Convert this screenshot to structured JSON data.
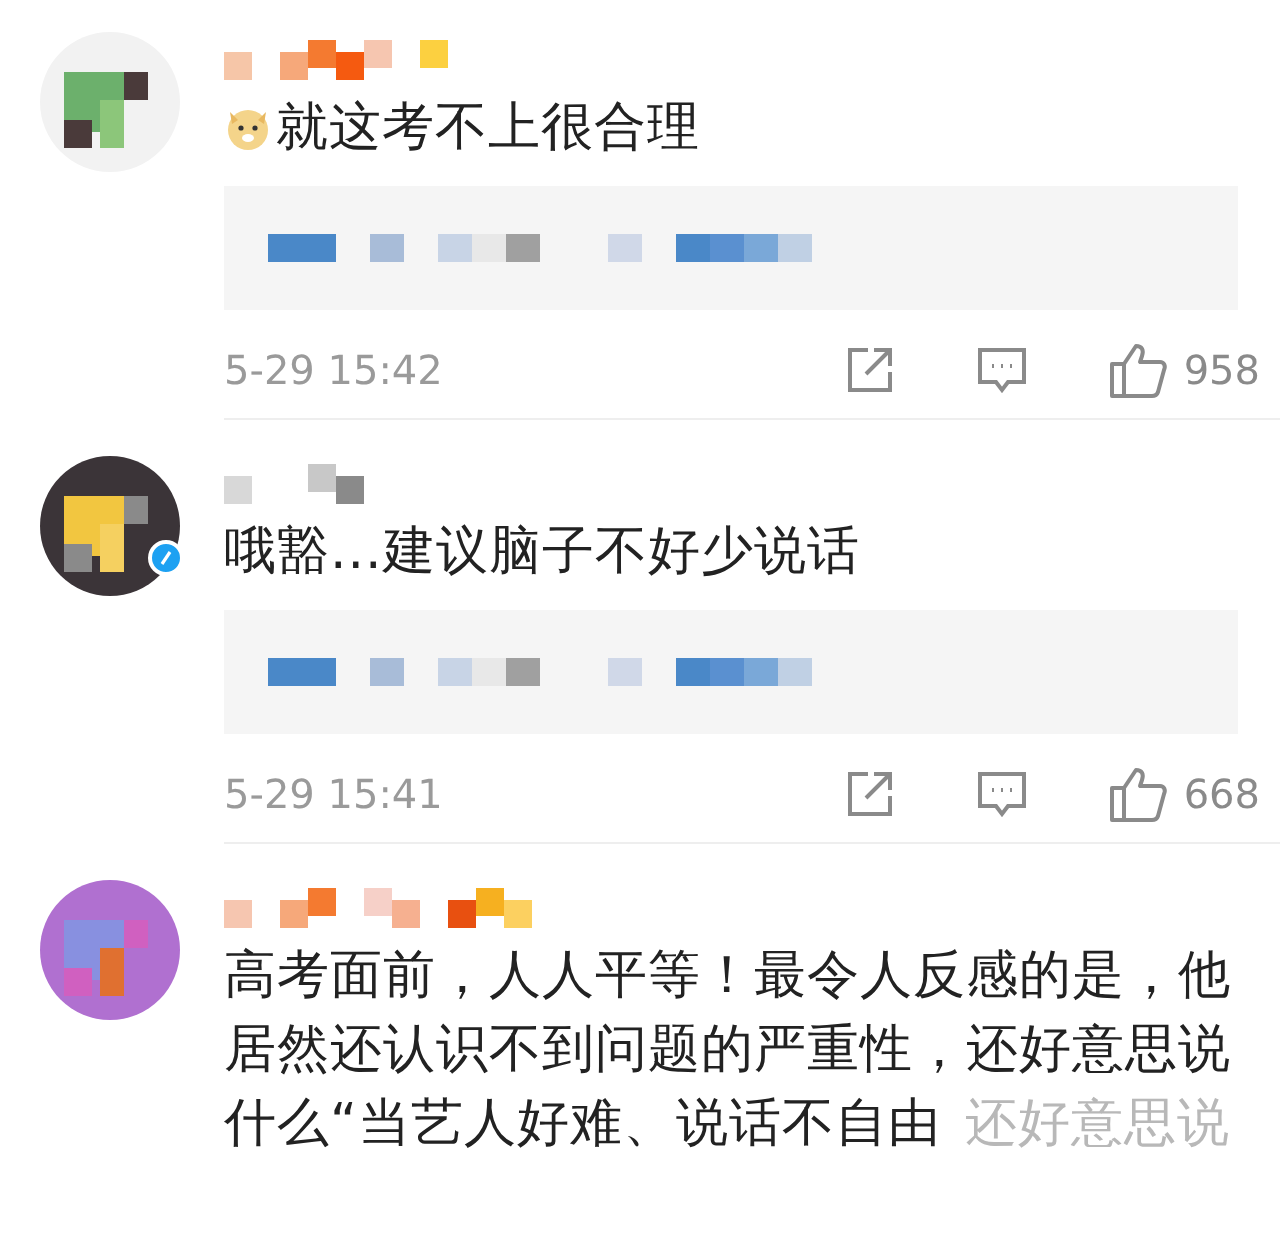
{
  "comments": [
    {
      "emoji": true,
      "verified": false,
      "text": "就这考不上很合理",
      "reply_preview": true,
      "time": "5-29 15:42",
      "likes": "958"
    },
    {
      "emoji": false,
      "verified": true,
      "text": "哦豁...建议脑子不好少说话",
      "reply_preview": true,
      "time": "5-29 15:41",
      "likes": "668"
    },
    {
      "emoji": false,
      "verified": false,
      "text": "高考面前，人人平等！最令人反感的是，他居然还认识不到问题的严重性，还好意思说什么“当艺人好难、说话不自由",
      "faded_tail": "还好意思说"
    }
  ]
}
